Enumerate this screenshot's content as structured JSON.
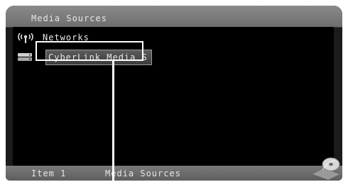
{
  "header": {
    "title": "Media Sources"
  },
  "list": {
    "items": [
      {
        "label": "Networks",
        "icon": "network-antenna-icon",
        "selected": false
      },
      {
        "label": "CyberLink Media S",
        "icon": "media-server-icon",
        "selected": true
      }
    ]
  },
  "footer": {
    "item_text": "Item 1",
    "section_text": "Media Sources"
  },
  "colors": {
    "frame": "#1b1b1b",
    "header": "#7c7c7c",
    "list_background": "#000000",
    "selection": "#4a4a4a",
    "text": "#e8e8e8",
    "callout": "#ffffff"
  },
  "corner_icon": "media-disc-icon"
}
